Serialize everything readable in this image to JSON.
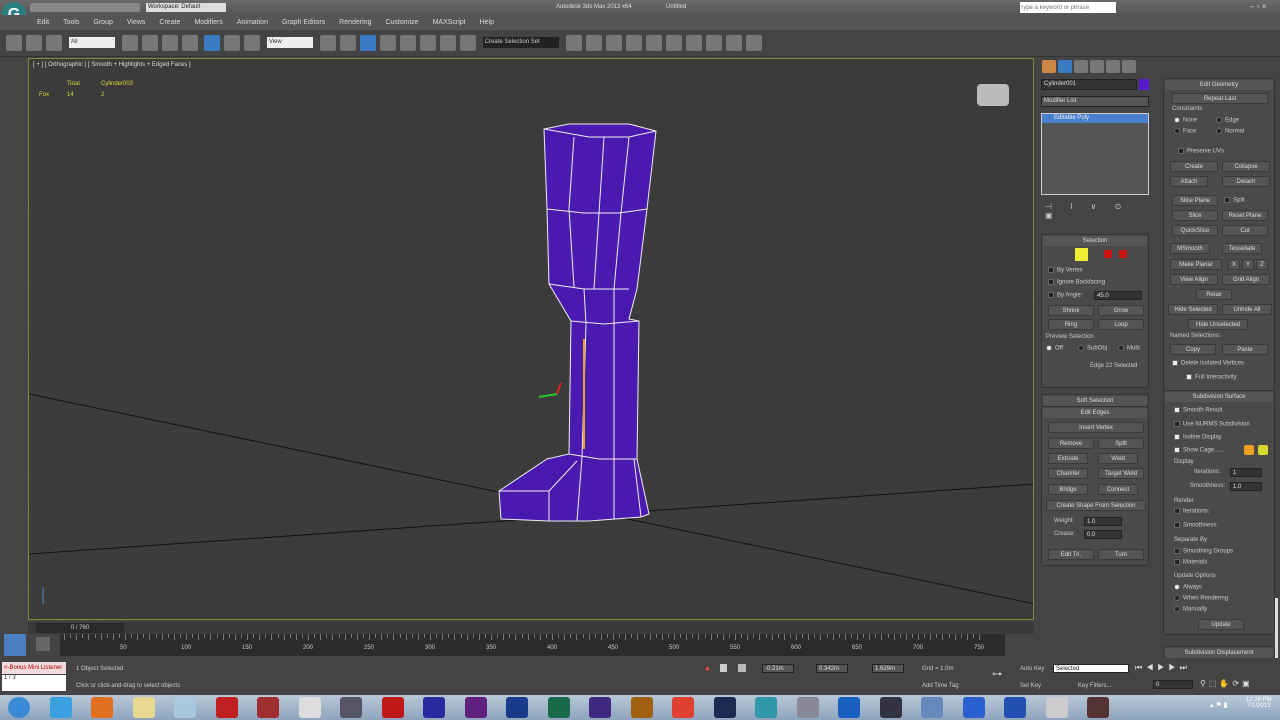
{
  "titlebar": {
    "workspace": "Workspace: Default",
    "title": "Autodesk 3ds Max 2013 x64",
    "file": "Untitled",
    "search_placeholder": "Type a keyword or phrase"
  },
  "menu": [
    "Edit",
    "Tools",
    "Group",
    "Views",
    "Create",
    "Modifiers",
    "Animation",
    "Graph Editors",
    "Rendering",
    "Customize",
    "MAXScript",
    "Help"
  ],
  "toolbar": {
    "selection_filter": "All",
    "ref_coord": "View",
    "named_selection": "Create Selection Set"
  },
  "viewport": {
    "label": "[ + ] [ Orthographic ] [ Smooth + Highlights + Edged Faces ]",
    "stats": {
      "col_total": "Total",
      "col_object": "Cylinder003",
      "row_label": "Fox",
      "total": "14",
      "object": "2"
    },
    "model_color": "#4a1ab0"
  },
  "command_panel": {
    "object_name": "Cylinder001",
    "object_color": "#5a1ad0",
    "modifier_list": "Modifier List",
    "stack_item": "Editable Poly",
    "selection": {
      "title": "Selection",
      "by_vertex": "By Vertex",
      "ignore_backfacing": "Ignore Backfacing",
      "by_angle": "By Angle:",
      "angle_value": "45.0",
      "shrink": "Shrink",
      "grow": "Grow",
      "ring": "Ring",
      "loop": "Loop",
      "preview": "Preview Selection",
      "off": "Off",
      "subobj": "SubObj",
      "multi": "Multi",
      "status": "Edge 22 Selected"
    },
    "soft_selection": "Soft Selection",
    "edit_edges": {
      "title": "Edit Edges",
      "insert_vertex": "Insert Vertex",
      "remove": "Remove",
      "split": "Split",
      "extrude": "Extrude",
      "weld": "Weld",
      "chamfer": "Chamfer",
      "target_weld": "Target Weld",
      "bridge": "Bridge",
      "connect": "Connect",
      "create_shape": "Create Shape From Selection",
      "weight": "Weight:",
      "weight_value": "1.0",
      "crease": "Crease:",
      "crease_value": "0.0",
      "edit_tri": "Edit Tri.",
      "turn": "Turn"
    },
    "edit_geometry": {
      "title": "Edit Geometry",
      "repeat_last": "Repeat Last",
      "constraints": "Constraints",
      "none": "None",
      "edge": "Edge",
      "face": "Face",
      "normal": "Normal",
      "preserve_uvs": "Preserve UVs",
      "create": "Create",
      "collapse": "Collapse",
      "attach": "Attach",
      "detach": "Detach",
      "slice_plane": "Slice Plane",
      "split": "Split",
      "slice": "Slice",
      "reset_plane": "Reset Plane",
      "quickslice": "QuickSlice",
      "cut": "Cut",
      "msmooth": "MSmooth",
      "tessellate": "Tessellate",
      "make_planar": "Make Planar",
      "x": "X",
      "y": "Y",
      "z": "Z",
      "view_align": "View Align",
      "grid_align": "Grid Align",
      "relax": "Relax",
      "hide_selected": "Hide Selected",
      "unhide_all": "Unhide All",
      "hide_unselected": "Hide Unselected",
      "named_selections": "Named Selections:",
      "copy": "Copy",
      "paste": "Paste",
      "delete_isolated": "Delete Isolated Vertices",
      "full_interactivity": "Full Interactivity"
    },
    "subdivision": {
      "title": "Subdivision Surface",
      "smooth_result": "Smooth Result",
      "use_nurms": "Use NURMS Subdivision",
      "isoline": "Isoline Display",
      "show_cage": "Show Cage......",
      "display": "Display",
      "iterations": "Iterations:",
      "iter_value": "1",
      "smoothness": "Smoothness:",
      "smooth_value": "1.0",
      "render": "Render",
      "separate_by": "Separate By",
      "smoothing_groups": "Smoothing Groups",
      "materials": "Materials",
      "update_options": "Update Options",
      "always": "Always",
      "when_rendering": "When Rendering",
      "manually": "Manually",
      "update": "Update",
      "cage_colors": [
        "#f0a020",
        "#d8d830"
      ]
    },
    "displacement": "Subdivision Displacement"
  },
  "timeline": {
    "frame": "0 / 760",
    "ticks": [
      "50",
      "100",
      "150",
      "200",
      "250",
      "300",
      "350",
      "400",
      "450",
      "500",
      "550",
      "600",
      "650",
      "700",
      "750"
    ]
  },
  "status": {
    "maxscript": "<-Bonus Mini Listener",
    "line2": "1 / 3",
    "selected": "1 Object Selected",
    "prompt": "Click or click-and-drag to select objects",
    "x": "-0.21m",
    "y": "0.342m",
    "z": "1.629m",
    "grid": "Grid = 1.0m",
    "add_time_tag": "Add Time Tag",
    "auto_key": "Auto Key",
    "set_key": "Set Key",
    "key_mode": "Selected",
    "key_filters": "Key Filters...",
    "frame_value": "0"
  },
  "taskbar": {
    "time": "12:26 PM",
    "date": "7/1/2013",
    "icons": [
      "start",
      "ie",
      "firefox",
      "explorer",
      "notepad",
      "filezilla",
      "app",
      "3dsmax",
      "app2",
      "acrobat",
      "after-effects",
      "premiere",
      "photoshop",
      "audition",
      "app3",
      "illustrator",
      "chrome",
      "lightroom",
      "app4",
      "app5",
      "quicktime",
      "app6",
      "app7",
      "flash",
      "app8",
      "disc",
      "app9"
    ]
  }
}
